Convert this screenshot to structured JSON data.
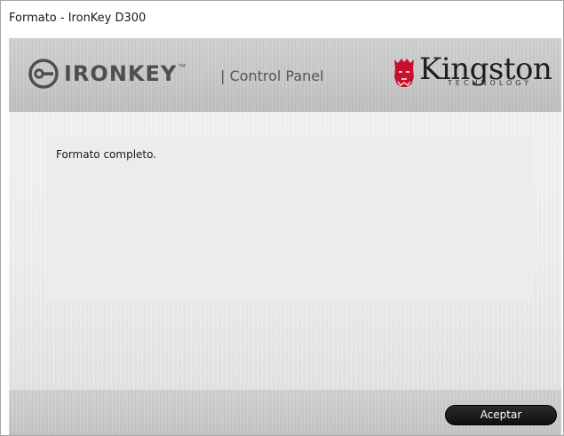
{
  "window": {
    "title": "Formato - IronKey D300"
  },
  "header": {
    "ironkey_logo": {
      "text": "IRONKEY",
      "trademark": "™",
      "icon": "key-icon",
      "color": "#4f4f4f"
    },
    "control_panel_label": "| Control Panel",
    "kingston_logo": {
      "wordmark": "Kingston",
      "tagline": "TECHNOLOGY",
      "icon": "king-head-icon",
      "brand_color": "#c8102e"
    }
  },
  "content": {
    "message": "Formato completo."
  },
  "footer": {
    "accept_label": "Aceptar"
  }
}
